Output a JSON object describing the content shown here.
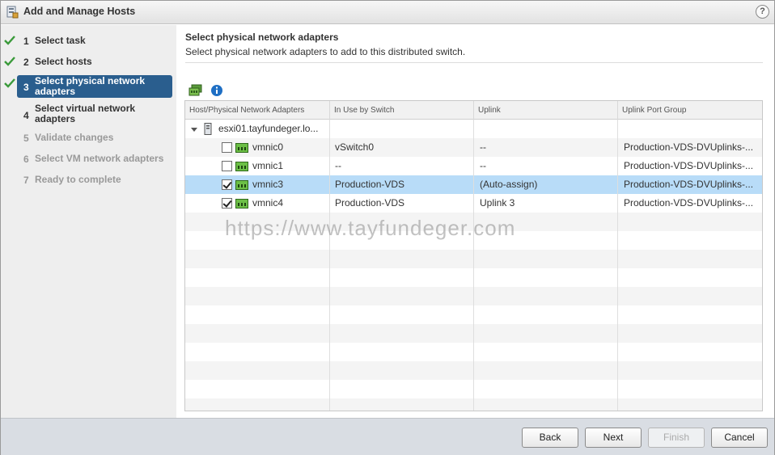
{
  "window": {
    "title": "Add and Manage Hosts",
    "help": "?"
  },
  "steps": [
    {
      "num": "1",
      "label": "Select task",
      "state": "done"
    },
    {
      "num": "2",
      "label": "Select hosts",
      "state": "done"
    },
    {
      "num": "3",
      "label": "Select physical network adapters",
      "state": "current"
    },
    {
      "num": "4",
      "label": "Select virtual network adapters",
      "state": "upcoming"
    },
    {
      "num": "5",
      "label": "Validate changes",
      "state": "future"
    },
    {
      "num": "6",
      "label": "Select VM network adapters",
      "state": "future"
    },
    {
      "num": "7",
      "label": "Ready to complete",
      "state": "future"
    }
  ],
  "content": {
    "title": "Select physical network adapters",
    "subtitle": "Select physical network adapters to add to this distributed switch."
  },
  "toolbar": {
    "icons": [
      "manage-adapters-icon",
      "info-icon"
    ]
  },
  "grid": {
    "columns": [
      "Host/Physical Network Adapters",
      "In Use by Switch",
      "Uplink",
      "Uplink Port Group"
    ],
    "host": "esxi01.tayfundeger.lo...",
    "rows": [
      {
        "name": "vmnic0",
        "checked": false,
        "switch": "vSwitch0",
        "uplink": "--",
        "portgroup": "Production-VDS-DVUplinks-...",
        "selected": false
      },
      {
        "name": "vmnic1",
        "checked": false,
        "switch": "--",
        "uplink": "--",
        "portgroup": "Production-VDS-DVUplinks-...",
        "selected": false
      },
      {
        "name": "vmnic3",
        "checked": true,
        "switch": "Production-VDS",
        "uplink": "(Auto-assign)",
        "portgroup": "Production-VDS-DVUplinks-...",
        "selected": true
      },
      {
        "name": "vmnic4",
        "checked": true,
        "switch": "Production-VDS",
        "uplink": "Uplink 3",
        "portgroup": "Production-VDS-DVUplinks-...",
        "selected": false
      }
    ]
  },
  "watermark": "https://www.tayfundeger.com",
  "buttons": {
    "back": "Back",
    "next": "Next",
    "finish": "Finish",
    "cancel": "Cancel"
  },
  "colors": {
    "accent": "#2a5e8e",
    "selection": "#b8dcf8",
    "check": "#3a9a3a"
  }
}
